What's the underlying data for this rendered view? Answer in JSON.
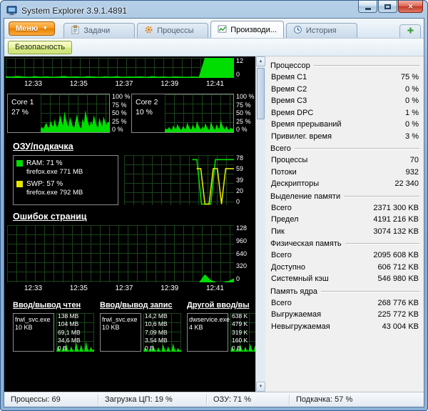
{
  "window": {
    "title": "System Explorer 3.9.1.4891"
  },
  "tabbar": {
    "menu_label": "Меню",
    "tabs": [
      {
        "label": "Задачи",
        "icon": "tasks-icon",
        "active": false
      },
      {
        "label": "Процессы",
        "icon": "processes-icon",
        "active": false
      },
      {
        "label": "Производи...",
        "icon": "performance-icon",
        "active": true
      },
      {
        "label": "История",
        "icon": "history-icon",
        "active": false
      }
    ],
    "add_tab_icon": "plus-icon"
  },
  "toolbar": {
    "security_label": "Безопасность"
  },
  "colors": {
    "chart_green": "#00dd00",
    "chart_yellow": "#e6e600",
    "menu_orange": "#f79a1e",
    "close_red": "#c33a28",
    "panel_bg": "#f0f0f0",
    "chart_bg": "#000000"
  },
  "charts": {
    "time_labels": [
      "12:33",
      "12:35",
      "12:37",
      "12:39",
      "12:41"
    ],
    "cpu_strip": {
      "ylabels": [
        "12",
        "0"
      ],
      "series": [
        {
          "color": "#00dd00",
          "fill": true,
          "points": [
            8,
            6,
            10,
            7,
            5,
            9,
            6,
            8,
            5,
            7,
            10,
            6,
            8,
            5,
            9,
            7,
            5,
            8,
            6,
            9,
            5,
            7,
            6,
            8,
            5,
            9,
            6,
            7,
            5,
            8,
            6,
            5,
            7,
            6,
            100,
            100,
            100,
            100,
            100,
            100
          ]
        }
      ]
    },
    "core1": {
      "name": "Core 1",
      "value": "27 %",
      "ylabels": [
        "100 %",
        "75 %",
        "50 %",
        "25 %",
        "0 %"
      ],
      "series": [
        {
          "color": "#00dd00",
          "fill": true,
          "points": [
            10,
            14,
            9,
            18,
            25,
            15,
            12,
            30,
            22,
            14,
            35,
            20,
            12,
            28,
            45,
            30,
            18,
            55,
            38,
            22,
            15,
            40,
            28,
            16,
            12,
            32,
            48,
            26,
            15,
            10,
            36,
            24,
            58,
            40,
            25,
            14,
            30,
            20,
            45,
            32,
            18,
            12,
            38,
            26,
            16,
            42,
            30,
            20,
            27,
            27
          ]
        }
      ]
    },
    "core2": {
      "name": "Core 2",
      "value": "10 %",
      "ylabels": [
        "100 %",
        "75 %",
        "50 %",
        "25 %",
        "0 %"
      ],
      "series": [
        {
          "color": "#00dd00",
          "fill": true,
          "points": [
            6,
            10,
            7,
            14,
            9,
            6,
            18,
            12,
            8,
            22,
            14,
            9,
            6,
            16,
            11,
            7,
            26,
            17,
            10,
            7,
            20,
            13,
            8,
            30,
            19,
            11,
            7,
            15,
            9,
            24,
            15,
            9,
            6,
            28,
            18,
            10,
            7,
            21,
            13,
            8,
            33,
            20,
            12,
            8,
            17,
            10,
            6,
            12,
            9,
            10
          ]
        }
      ]
    },
    "ram": {
      "heading": "ОЗУ/подкачка",
      "ylabels": [
        "78",
        "59",
        "39",
        "20",
        "0"
      ],
      "legend": [
        {
          "color": "#00dd00",
          "label": "RAM: 71 %",
          "detail": "firefox.exe 771 MB"
        },
        {
          "color": "#e6e600",
          "label": "SWP: 57 %",
          "detail": "firefox.exe 792 MB"
        }
      ],
      "series": [
        {
          "color": "#00dd00",
          "fill": false,
          "start": 0.62,
          "points": [
            91,
            91,
            2,
            2,
            2,
            91,
            91,
            91,
            91,
            91
          ]
        },
        {
          "color": "#e6e600",
          "fill": false,
          "start": 0.66,
          "points": [
            73,
            73,
            2,
            2,
            73,
            73,
            2,
            73,
            73,
            73
          ]
        }
      ]
    },
    "pagefaults": {
      "heading": "Ошибок страниц",
      "ylabels": [
        "128",
        "960",
        "640",
        "320",
        "0"
      ],
      "series": [
        {
          "color": "#00dd00",
          "fill": true,
          "points": [
            0,
            0,
            0,
            0,
            0,
            0,
            0,
            0,
            0,
            0,
            0,
            0,
            0,
            0,
            0,
            0,
            0,
            0,
            0,
            0,
            0,
            0,
            0,
            0,
            0,
            0,
            0,
            0,
            0,
            0,
            0,
            0,
            0,
            0,
            14,
            4,
            0,
            0,
            2,
            7
          ]
        }
      ]
    },
    "io": [
      {
        "heading": "Ввод/вывод чтен",
        "proc": "frwl_svc.exe",
        "value": "10 KB",
        "scale": [
          "138 MB",
          "104 MB",
          "69,1 MB",
          "34,6 MB",
          "0 В"
        ],
        "series": [
          {
            "color": "#00dd00",
            "fill": true,
            "points": [
              0,
              16,
              5,
              0,
              11,
              0,
              20,
              6,
              0,
              14,
              4,
              0,
              24,
              8,
              0,
              18,
              5,
              0,
              27,
              9,
              0,
              13,
              4,
              6
            ]
          }
        ]
      },
      {
        "heading": "Ввод/вывод запис",
        "proc": "frwl_svc.exe",
        "value": "10 KB",
        "scale": [
          "14,2 MB",
          "10,6 MB",
          "7,09 MB",
          "3,54 MB",
          "0 В"
        ],
        "series": [
          {
            "color": "#00dd00",
            "fill": true,
            "points": [
              0,
              12,
              4,
              0,
              9,
              0,
              16,
              5,
              0,
              11,
              3,
              0,
              19,
              6,
              0,
              14,
              4,
              0,
              22,
              7,
              0,
              10,
              3,
              5
            ]
          }
        ]
      },
      {
        "heading": "Другой ввод/вы",
        "proc": "dwservice.exe",
        "value": "4 KB",
        "scale": [
          "638 K",
          "479 K",
          "319 K",
          "160 K",
          "0 В"
        ],
        "series": [
          {
            "color": "#00dd00",
            "fill": true,
            "points": [
              0,
              14,
              5,
              0,
              10,
              0,
              18,
              6,
              0,
              13,
              4,
              0,
              21,
              7,
              0,
              16,
              5,
              0,
              25,
              8,
              0,
              12,
              4,
              7
            ]
          }
        ]
      }
    ]
  },
  "stats": {
    "groups": [
      {
        "title": "Процессор",
        "rows": [
          [
            "Время C1",
            "75 %"
          ],
          [
            "Время C2",
            "0 %"
          ],
          [
            "Время C3",
            "0 %"
          ],
          [
            "Время DPC",
            "1 %"
          ],
          [
            "Время прерываний",
            "0 %"
          ],
          [
            "Привилег. время",
            "3 %"
          ]
        ]
      },
      {
        "title": "Всего",
        "rows": [
          [
            "Процессы",
            "70"
          ],
          [
            "Потоки",
            "932"
          ],
          [
            "Дескрипторы",
            "22 340"
          ]
        ]
      },
      {
        "title": "Выделение памяти",
        "rows": [
          [
            "Всего",
            "2371 300 KB"
          ],
          [
            "Предел",
            "4191 216 KB"
          ],
          [
            "Пик",
            "3074 132 KB"
          ]
        ]
      },
      {
        "title": "Физическая память",
        "rows": [
          [
            "Всего",
            "2095 608 KB"
          ],
          [
            "Доступно",
            "606 712 KB"
          ],
          [
            "Системный кэш",
            "546 980 KB"
          ]
        ]
      },
      {
        "title": "Память ядра",
        "rows": [
          [
            "Всего",
            "268 776 KB"
          ],
          [
            "Выгружаемая",
            "225 772 KB"
          ],
          [
            "Невыгружаемая",
            "43 004 KB"
          ]
        ]
      }
    ]
  },
  "statusbar": {
    "segments": [
      "Процессы: 69",
      "Загрузка ЦП: 19 %",
      "ОЗУ: 71 %",
      "Подкачка: 57 %"
    ]
  }
}
